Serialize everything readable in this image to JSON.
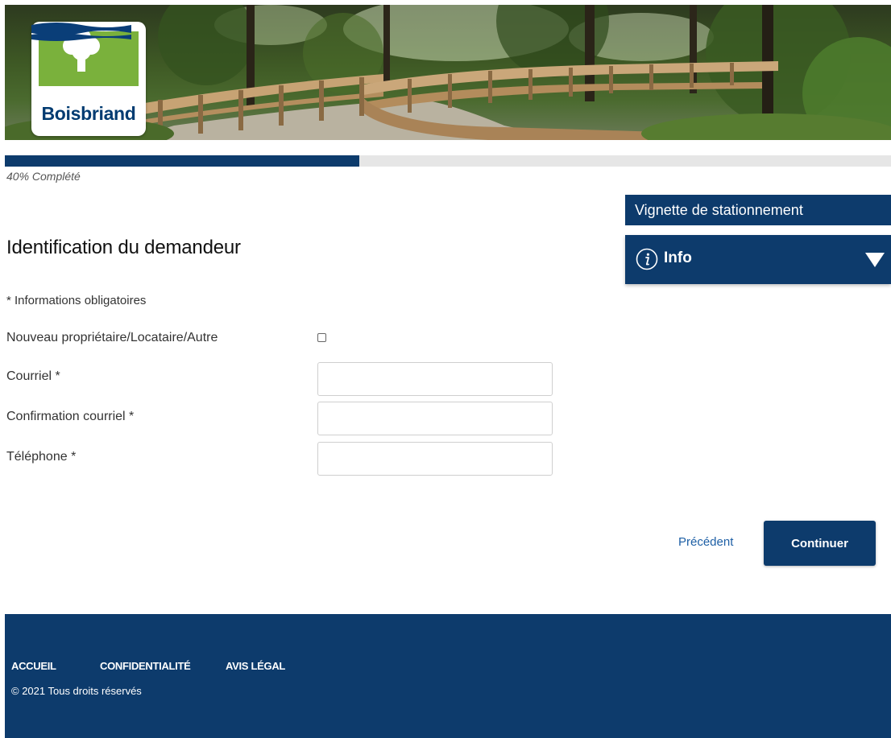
{
  "header": {
    "logo_text": "Boisbriand"
  },
  "progress": {
    "percent": 40,
    "label": "40% Complété"
  },
  "side_panel": {
    "title": "Vignette de stationnement",
    "info_label": "Info"
  },
  "form": {
    "title": "Identification du demandeur",
    "required_note": "* Informations obligatoires",
    "fields": [
      {
        "label": "Nouveau propriétaire/Locataire/Autre",
        "type": "checkbox",
        "checked": false
      },
      {
        "label": "Courriel *",
        "type": "text",
        "value": ""
      },
      {
        "label": "Confirmation courriel *",
        "type": "text",
        "value": ""
      },
      {
        "label": "Téléphone *",
        "type": "text",
        "value": ""
      }
    ]
  },
  "actions": {
    "previous_label": "Précédent",
    "continue_label": "Continuer"
  },
  "footer": {
    "links": [
      "ACCUEIL",
      "CONFIDENTIALITÉ",
      "AVIS LÉGAL"
    ],
    "copyright": "© 2021 Tous droits réservés"
  },
  "colors": {
    "brand_navy": "#0d3b6c",
    "logo_green": "#7ab13c",
    "link_blue": "#1d5fa5"
  }
}
